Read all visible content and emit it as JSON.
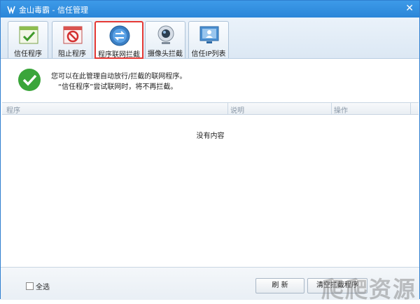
{
  "window": {
    "title": "金山毒霸 - 信任管理",
    "close_symbol": "✕"
  },
  "tabs": [
    {
      "label": "信任程序",
      "icon": "trusted-program-icon"
    },
    {
      "label": "阻止程序",
      "icon": "blocked-program-icon"
    },
    {
      "label": "程序联网拦截",
      "icon": "network-intercept-icon",
      "active": true
    },
    {
      "label": "摄像头拦截",
      "icon": "webcam-icon"
    },
    {
      "label": "信任IP列表",
      "icon": "ip-list-icon"
    }
  ],
  "info": {
    "line1": "您可以在此管理自动放行/拦截的联网程序。",
    "line2": "“信任程序”尝试联网时，将不再拦截。"
  },
  "table": {
    "columns": [
      "程序",
      "说明",
      "操作"
    ],
    "empty_text": "没有内容"
  },
  "footer": {
    "select_all": "全选",
    "refresh": "刷 新",
    "clear": "清空拦截程序",
    "watermark": "爬爬资源"
  },
  "colors": {
    "titlebar": "#2a86d8",
    "active_tab_border": "#e53935",
    "check_green": "#3aa53a"
  }
}
